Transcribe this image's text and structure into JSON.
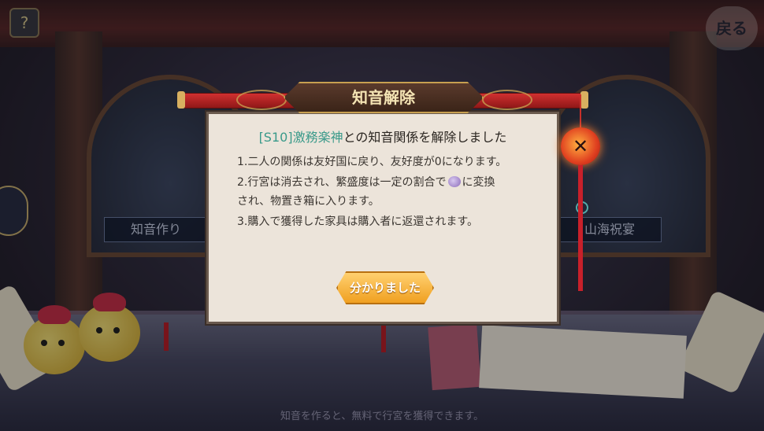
{
  "background": {
    "help_label": "?",
    "logo_text": "戻る",
    "left_tab_label": "知音作り",
    "right_tab_label": "山海祝宴",
    "bottom_hint": "知音を作ると、無料で行宮を獲得できます。"
  },
  "dialog": {
    "title": "知音解除",
    "headline_server": "[S10]",
    "headline_partner": "激務楽神",
    "headline_rest": "との知音関係を解除しました",
    "line1": "1.二人の関係は友好国に戻り、友好度が0になります。",
    "line2a": "2.行宮は消去され、繁盛度は一定の割合で",
    "line2b": "に変換",
    "line2c": "され、物置き箱に入ります。",
    "line3": "3.購入で獲得した家具は購入者に返還されます。",
    "confirm_label": "分かりました",
    "close_label": "✕",
    "currency_icon": "coin-purse-icon"
  },
  "colors": {
    "accent_teal": "#3a9a8a",
    "button_orange": "#f0a020",
    "title_red": "#d03030"
  }
}
